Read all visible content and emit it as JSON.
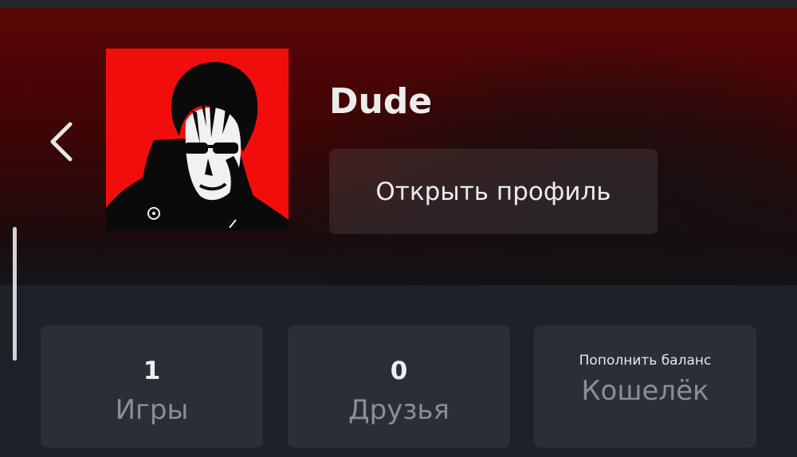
{
  "profile": {
    "username": "Dude",
    "open_profile_label": "Открыть профиль",
    "accent_color": "#f20d0d"
  },
  "navigation": {
    "back_icon": "chevron-left-icon"
  },
  "stats": [
    {
      "value": "1",
      "label": "Игры"
    },
    {
      "value": "0",
      "label": "Друзья"
    }
  ],
  "wallet": {
    "action_label": "Пополнить баланс",
    "label": "Кошелёк"
  },
  "colors": {
    "hero_gradient_top": "#5a0606",
    "page_background": "#1e2128",
    "card_background": "#2a2e36"
  }
}
